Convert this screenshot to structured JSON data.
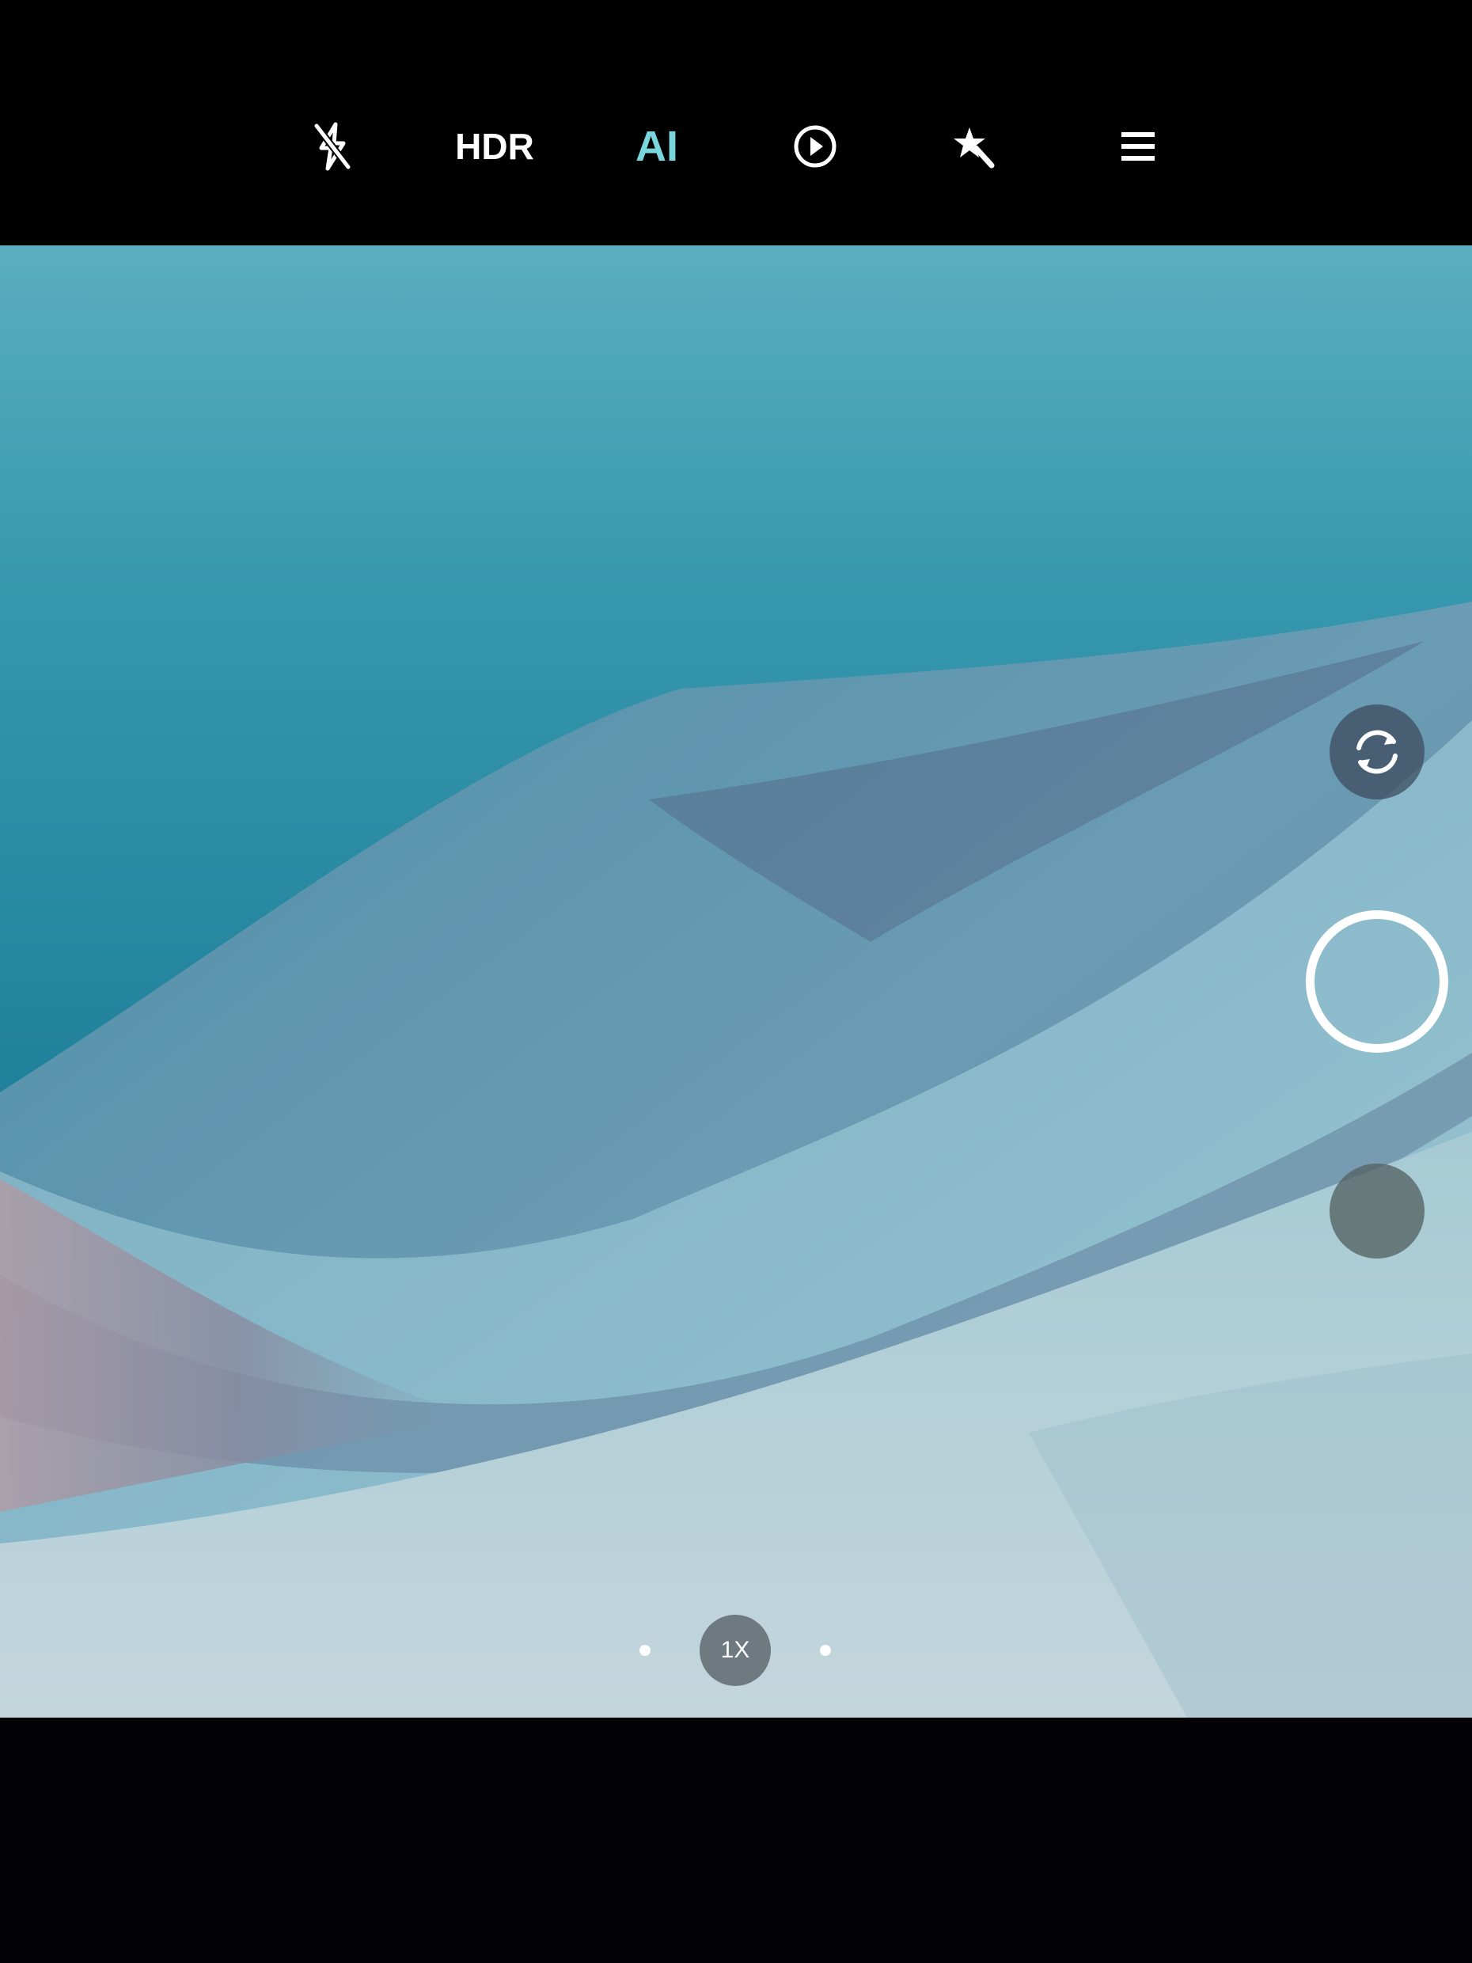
{
  "toolbar": {
    "flash": {
      "icon": "flash-off-icon",
      "state": "off"
    },
    "hdr_label": "HDR",
    "ai_label": "AI",
    "ai_active": true,
    "live_photo": {
      "icon": "live-photo-icon"
    },
    "beauty": {
      "icon": "magic-wand-icon"
    },
    "menu": {
      "icon": "menu-icon"
    }
  },
  "camera_controls": {
    "switch_camera": {
      "icon": "switch-camera-icon"
    },
    "shutter": {
      "icon": "shutter-button"
    },
    "gallery_thumbnail": {
      "icon": "gallery-thumbnail"
    }
  },
  "zoom": {
    "current_label": "1X",
    "levels_count": 3,
    "selected_index": 1
  },
  "colors": {
    "background": "#000000",
    "accent": "#7ad6dd",
    "icon": "#ffffff"
  }
}
